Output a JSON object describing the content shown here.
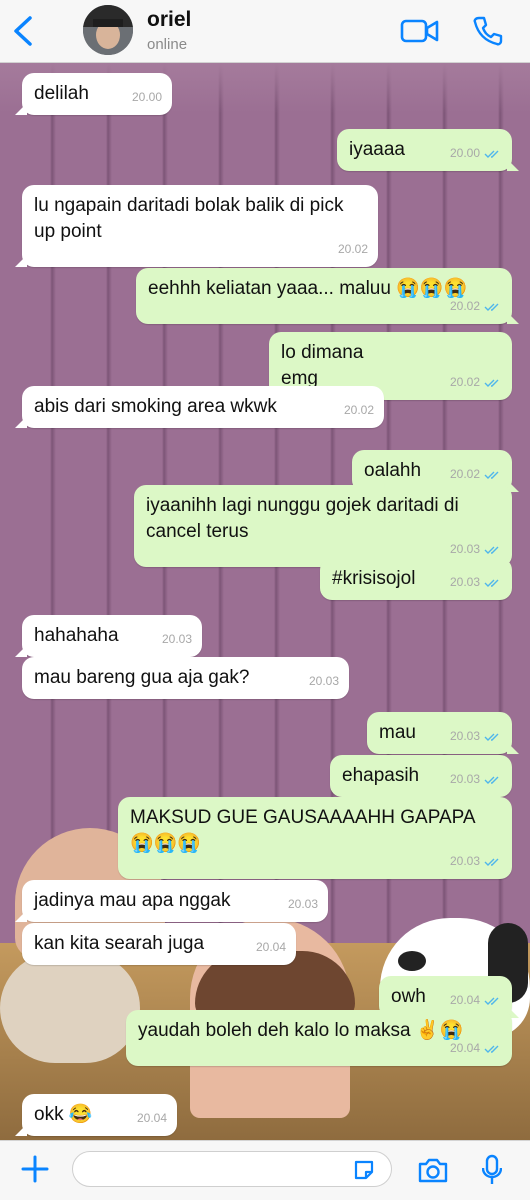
{
  "header": {
    "contact_name": "oriel",
    "status": "online"
  },
  "icons": {
    "back": "chevron-left-icon",
    "video": "video-camera-icon",
    "call": "phone-icon",
    "plus": "plus-icon",
    "sticker": "sticker-icon",
    "camera": "camera-icon",
    "mic": "microphone-icon",
    "read": "double-check-icon"
  },
  "colors": {
    "accent": "#0a84ff",
    "outgoing_bubble": "#dcf8c6",
    "incoming_bubble": "#ffffff",
    "read_ticks": "#4fb6ec",
    "wallpaper": "#9b6f93"
  },
  "messages": [
    {
      "dir": "in",
      "text": "delilah",
      "time": "20.00"
    },
    {
      "dir": "out",
      "text": "iyaaaa",
      "time": "20.00"
    },
    {
      "dir": "in",
      "text": "lu ngapain daritadi bolak balik di pick up point",
      "time": "20.02"
    },
    {
      "dir": "out",
      "text": "eehhh keliatan yaaa... maluu 😭😭😭",
      "time": "20.02"
    },
    {
      "dir": "out",
      "text": "lo dimana emg",
      "time": "20.02"
    },
    {
      "dir": "in",
      "text": "abis dari smoking area wkwk",
      "time": "20.02"
    },
    {
      "dir": "out",
      "text": "oalahh",
      "time": "20.02"
    },
    {
      "dir": "out",
      "text": "iyaanihh lagi nunggu gojek daritadi di cancel terus",
      "time": "20.03"
    },
    {
      "dir": "out",
      "text": "#krisisojol",
      "time": "20.03"
    },
    {
      "dir": "in",
      "text": "hahahaha",
      "time": "20.03"
    },
    {
      "dir": "in",
      "text": "mau bareng gua aja gak?",
      "time": "20.03"
    },
    {
      "dir": "out",
      "text": "mau",
      "time": "20.03"
    },
    {
      "dir": "out",
      "text": "ehapasih",
      "time": "20.03"
    },
    {
      "dir": "out",
      "text": "MAKSUD GUE GAUSAAAAHH GAPAPA 😭😭😭",
      "time": "20.03"
    },
    {
      "dir": "in",
      "text": "jadinya mau apa nggak",
      "time": "20.03"
    },
    {
      "dir": "in",
      "text": "kan kita searah juga",
      "time": "20.04"
    },
    {
      "dir": "out",
      "text": "owh",
      "time": "20.04"
    },
    {
      "dir": "out",
      "text": "yaudah boleh deh kalo lo maksa ✌️😭",
      "time": "20.04"
    },
    {
      "dir": "in",
      "text": "okk 😂",
      "time": "20.04"
    }
  ],
  "composer": {
    "value": ""
  }
}
